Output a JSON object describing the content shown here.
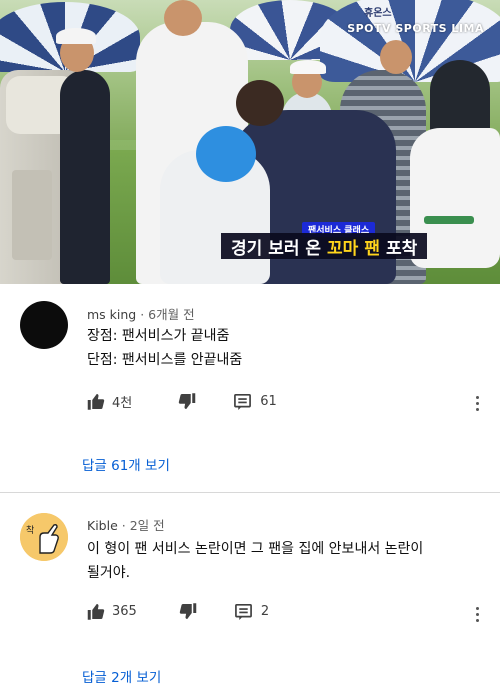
{
  "video": {
    "broadcast_logo": "SPOTV SPORTS LIMA",
    "umbrella_text": "휴온스",
    "caption_tag": "팬서비스 클래스",
    "caption_parts": [
      "경기 보러 온",
      "꼬마",
      "팬",
      "포착"
    ]
  },
  "comments": [
    {
      "author": "ms king",
      "time": "6개월 전",
      "lines": [
        "장점: 팬서비스가 끝내줌",
        "단점: 팬서비스를 안끝내줌"
      ],
      "likes": "4천",
      "reply_count": "61",
      "replies_link": "답글 61개 보기",
      "avatar": "black-circle"
    },
    {
      "author": "Kible",
      "time": "2일 전",
      "lines": [
        "이 형이 팬 서비스 논란이면 그 팬을 집에 안보내서 논란이",
        "될거야."
      ],
      "likes": "365",
      "reply_count": "2",
      "replies_link": "답글 2개 보기",
      "avatar": "hand-drawing"
    }
  ],
  "icons": {
    "like": "thumbs-up-icon",
    "dislike": "thumbs-down-icon",
    "reply": "comment-icon",
    "more": "more-vert-icon"
  },
  "colors": {
    "link": "#065fd4",
    "caption_bg": "#0a0a1e",
    "caption_highlight": "#ffd51c",
    "caption_tag": "#1c2ad6"
  }
}
